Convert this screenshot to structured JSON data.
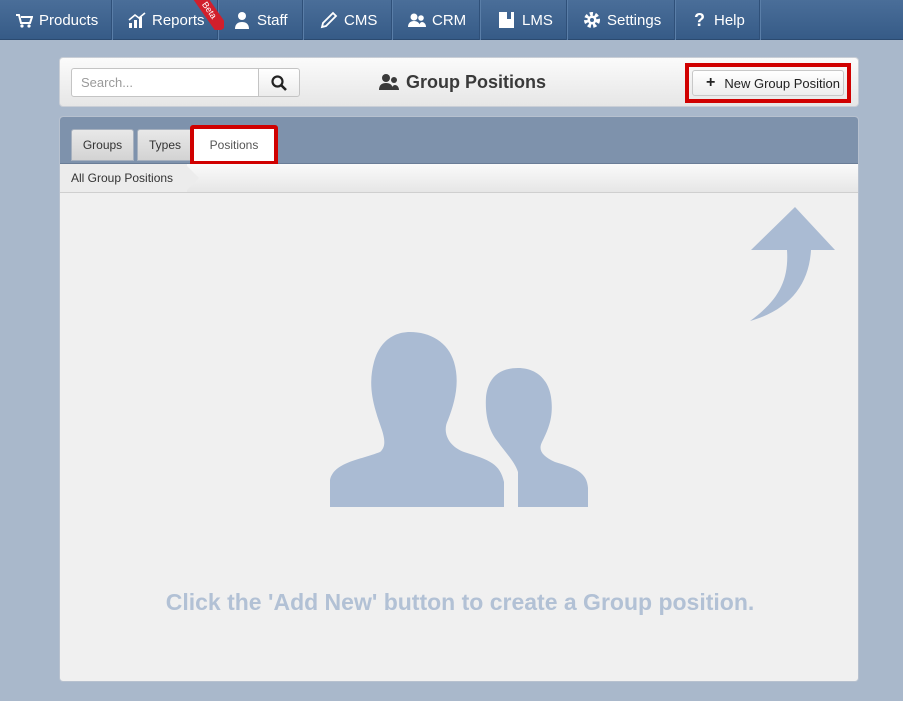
{
  "topnav": {
    "items": [
      {
        "label": "Products",
        "icon": "cart-icon"
      },
      {
        "label": "Reports",
        "icon": "chart-icon",
        "badge": "Beta"
      },
      {
        "label": "Staff",
        "icon": "person-icon"
      },
      {
        "label": "CMS",
        "icon": "pencil-icon"
      },
      {
        "label": "CRM",
        "icon": "people-icon"
      },
      {
        "label": "LMS",
        "icon": "book-icon"
      },
      {
        "label": "Settings",
        "icon": "gear-icon"
      },
      {
        "label": "Help",
        "icon": "question-icon"
      }
    ]
  },
  "header": {
    "search_placeholder": "Search...",
    "title": "Group Positions",
    "new_button_label": "New Group Position"
  },
  "tabs": [
    {
      "label": "Groups",
      "active": false
    },
    {
      "label": "Types",
      "active": false
    },
    {
      "label": "Positions",
      "active": true
    }
  ],
  "breadcrumb": "All Group Positions",
  "empty_message": "Click the 'Add New' button to create a Group position.",
  "colors": {
    "accent_red": "#d00000",
    "nav_blue": "#3f6592",
    "placeholder_blue": "#aabbd3"
  }
}
